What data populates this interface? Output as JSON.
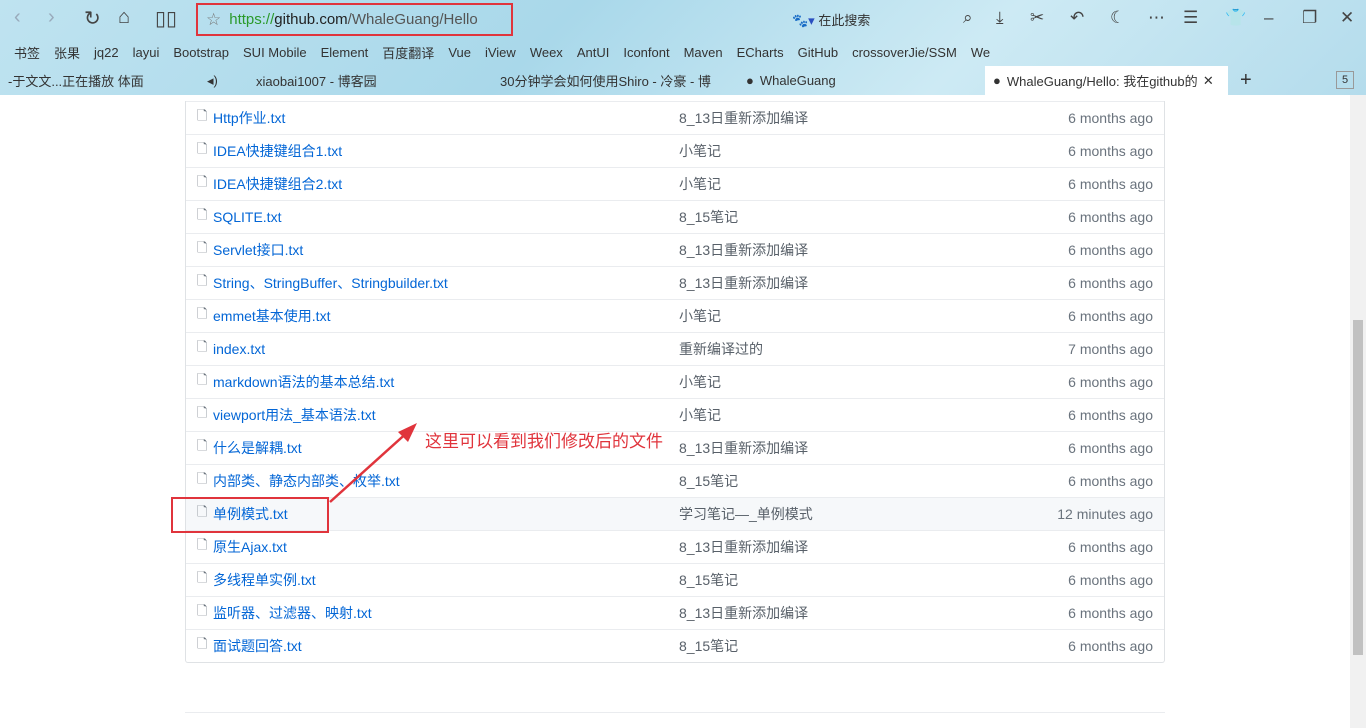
{
  "browser": {
    "url": {
      "scheme": "https://",
      "host": "github.com",
      "path": "/WhaleGuang/Hello"
    },
    "search_placeholder": "在此搜索",
    "bookmarks": [
      "书签",
      "张果",
      "jq22",
      "layui",
      "Bootstrap",
      "SUI Mobile",
      "Element",
      "百度翻译",
      "Vue",
      "iView",
      "Weex",
      "AntUI",
      "Iconfont",
      "Maven",
      "ECharts",
      "GitHub",
      "crossoverJie/SSM",
      "We"
    ],
    "tabs": [
      "-于文文...正在播放 体面",
      "xiaobai1007 - 博客园",
      "30分钟学会如何使用Shiro - 冷豪 - 博",
      "WhaleGuang",
      "WhaleGuang/Hello: 我在github的"
    ],
    "tab_count": "5"
  },
  "files": [
    {
      "name": "Http作业.txt",
      "message": "8_13日重新添加编译",
      "age": "6 months ago"
    },
    {
      "name": "IDEA快捷键组合1.txt",
      "message": "小笔记",
      "age": "6 months ago"
    },
    {
      "name": "IDEA快捷键组合2.txt",
      "message": "小笔记",
      "age": "6 months ago"
    },
    {
      "name": "SQLITE.txt",
      "message": "8_15笔记",
      "age": "6 months ago"
    },
    {
      "name": "Servlet接口.txt",
      "message": "8_13日重新添加编译",
      "age": "6 months ago"
    },
    {
      "name": "String、StringBuffer、Stringbuilder.txt",
      "message": "8_13日重新添加编译",
      "age": "6 months ago"
    },
    {
      "name": "emmet基本使用.txt",
      "message": "小笔记",
      "age": "6 months ago"
    },
    {
      "name": "index.txt",
      "message": "重新编译过的",
      "age": "7 months ago"
    },
    {
      "name": "markdown语法的基本总结.txt",
      "message": "小笔记",
      "age": "6 months ago"
    },
    {
      "name": "viewport用法_基本语法.txt",
      "message": "小笔记",
      "age": "6 months ago"
    },
    {
      "name": "什么是解耦.txt",
      "message": "8_13日重新添加编译",
      "age": "6 months ago"
    },
    {
      "name": "内部类、静态内部类、枚举.txt",
      "message": "8_15笔记",
      "age": "6 months ago"
    },
    {
      "name": "单例模式.txt",
      "message": "学习笔记—_单例模式",
      "age": "12 minutes ago"
    },
    {
      "name": "原生Ajax.txt",
      "message": "8_13日重新添加编译",
      "age": "6 months ago"
    },
    {
      "name": "多线程单实例.txt",
      "message": "8_15笔记",
      "age": "6 months ago"
    },
    {
      "name": "监听器、过滤器、映射.txt",
      "message": "8_13日重新添加编译",
      "age": "6 months ago"
    },
    {
      "name": "面试题回答.txt",
      "message": "8_15笔记",
      "age": "6 months ago"
    }
  ],
  "annotation": {
    "text": "这里可以看到我们修改后的文件",
    "color": "#e0343c"
  }
}
